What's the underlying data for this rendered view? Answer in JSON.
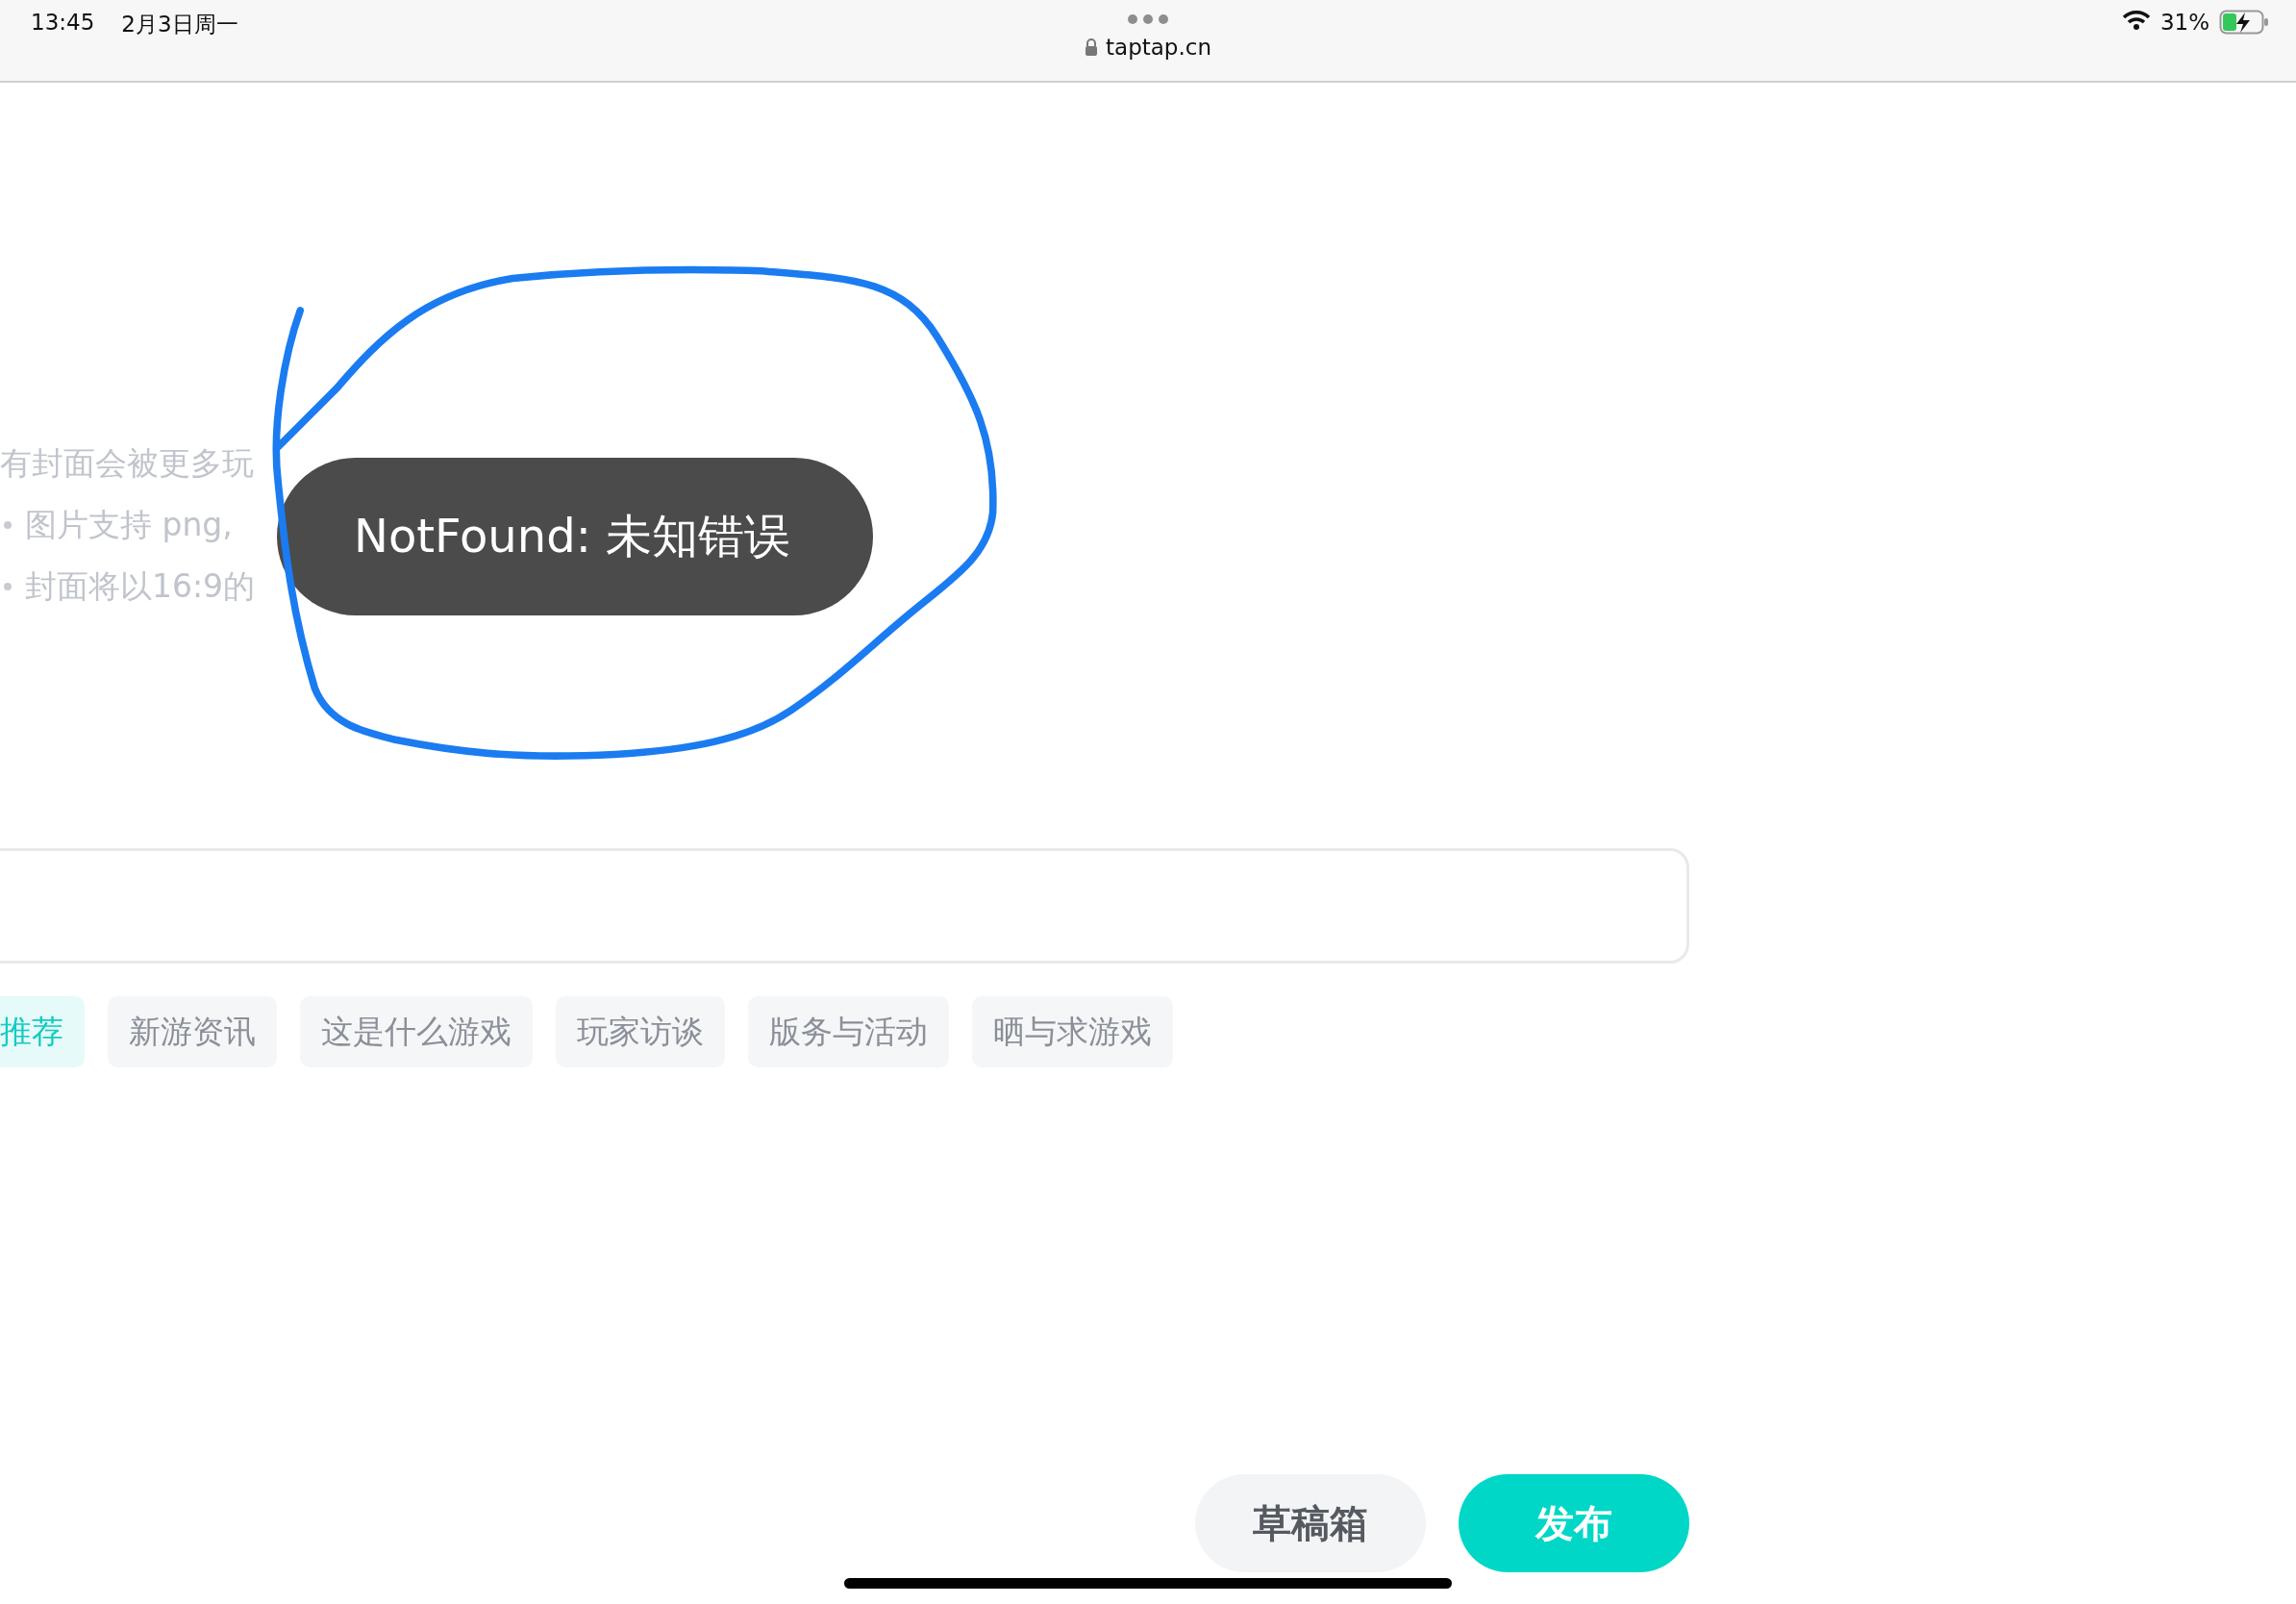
{
  "status_bar": {
    "time": "13:45",
    "date": "2月3日周一",
    "url": "taptap.cn",
    "battery": "31%"
  },
  "hints": [
    {
      "kind": "plain",
      "text": "有封面会被更多玩"
    },
    {
      "kind": "bullet",
      "text": "图片支持 png,"
    },
    {
      "kind": "bullet",
      "text": "封面将以16:9的"
    }
  ],
  "toast": {
    "text": "NotFound: 未知错误"
  },
  "tags": [
    {
      "label": "推荐",
      "selected": true
    },
    {
      "label": "新游资讯",
      "selected": false
    },
    {
      "label": "这是什么游戏",
      "selected": false
    },
    {
      "label": "玩家访谈",
      "selected": false
    },
    {
      "label": "版务与活动",
      "selected": false
    },
    {
      "label": "晒与求游戏",
      "selected": false
    }
  ],
  "buttons": [
    {
      "kind": "secondary",
      "label": "草稿箱"
    },
    {
      "kind": "primary",
      "label": "发布"
    }
  ]
}
